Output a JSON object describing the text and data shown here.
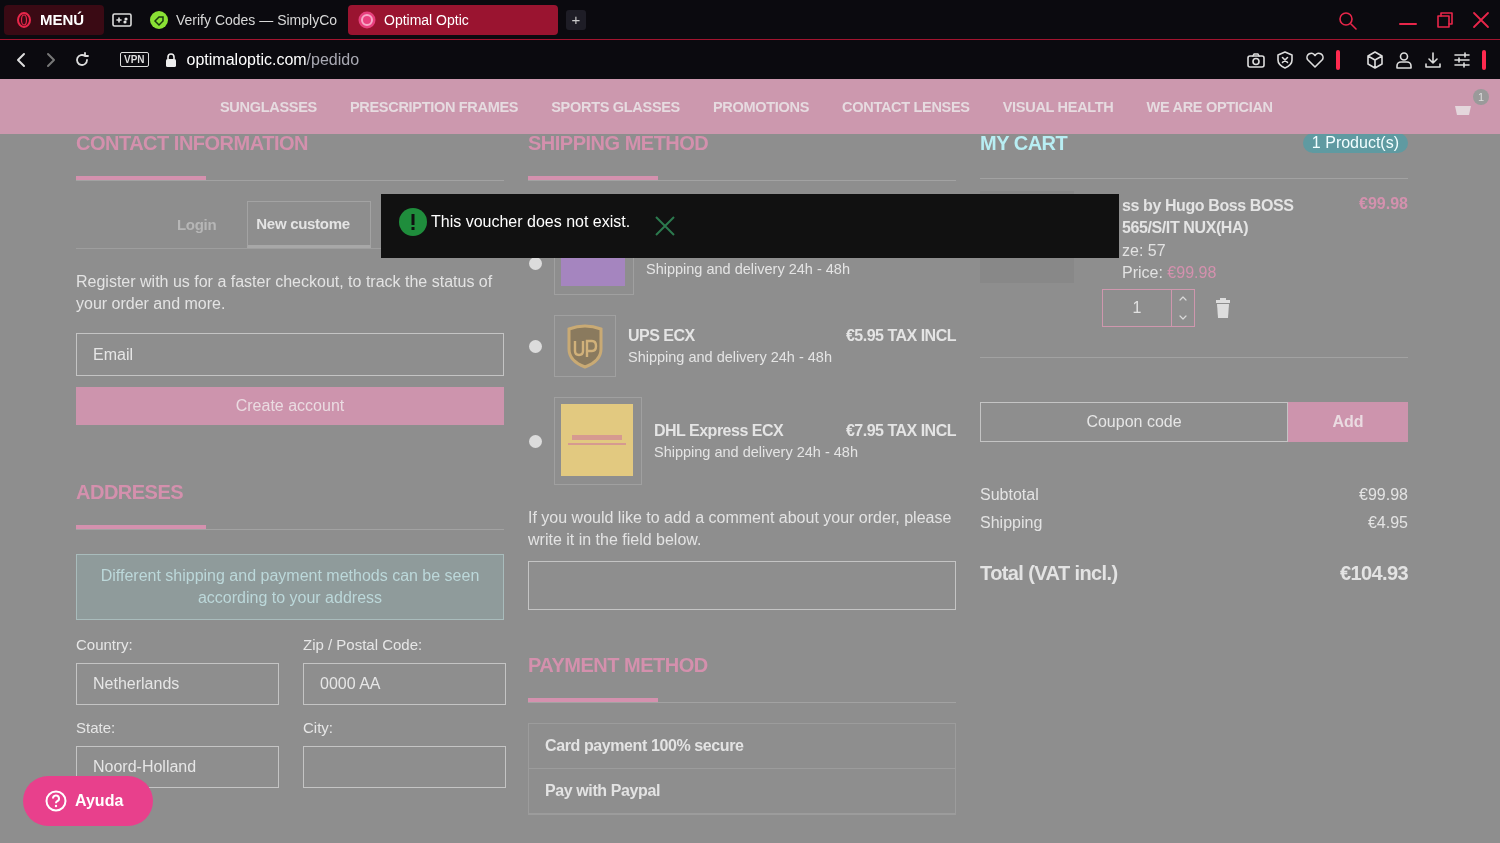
{
  "browser": {
    "menu_label": "MENÚ",
    "tabs": [
      {
        "title": "Verify Codes — SimplyCo",
        "selected": false
      },
      {
        "title": "Optimal Optic",
        "selected": true
      }
    ],
    "new_tab": "+",
    "vpn": "VPN",
    "url_host": "optimaloptic.com",
    "url_path": "/pedido"
  },
  "nav": {
    "items": [
      "SUNGLASSES",
      "PRESCRIPTION FRAMES",
      "SPORTS GLASSES",
      "PROMOTIONS",
      "CONTACT LENSES",
      "VISUAL HEALTH",
      "WE ARE OPTICIAN"
    ],
    "cart_count": "1"
  },
  "contact": {
    "title": "CONTACT INFORMATION",
    "tabs": [
      {
        "label": "Login",
        "selected": false
      },
      {
        "label": "New custome",
        "selected": true
      }
    ],
    "text": "Register with us for a faster checkout, to track the status of your order and more.",
    "email_placeholder": "Email",
    "button": "Create account"
  },
  "addresses": {
    "title": "ADDRESES",
    "notice": "Different shipping and payment methods can be seen according to your address",
    "fields": [
      {
        "label": "Country:",
        "value": "Netherlands"
      },
      {
        "label": "Zip / Postal Code:",
        "value": "0000 AA"
      },
      {
        "label": "State:",
        "value": "Noord-Holland"
      },
      {
        "label": "City:"
      }
    ]
  },
  "shipping": {
    "title": "SHIPPING METHOD",
    "options": [
      {
        "kind": "fedex",
        "selected": false,
        "delivery": "Shipping and delivery 24h - 48h"
      },
      {
        "kind": "ups",
        "selected": false,
        "name": "UPS ECX",
        "price": "€5.95 TAX INCL",
        "delivery": "Shipping and delivery 24h - 48h"
      },
      {
        "kind": "dhl",
        "selected": false,
        "name": "DHL Express ECX",
        "price": "€7.95 TAX INCL",
        "delivery": "Shipping and delivery 24h - 48h"
      }
    ],
    "comment_text": "If you would like to add a comment about your order, please write it in the field below."
  },
  "payment": {
    "title": "PAYMENT METHOD",
    "options": [
      "Card payment 100% secure",
      "Pay with Paypal"
    ]
  },
  "cart": {
    "title": "MY CART",
    "count": "1 Product(s)",
    "product": {
      "name_lines": [
        "ss by Hugo Boss BOSS",
        "565/S/IT NUX(HA)"
      ],
      "line_price": "€99.98",
      "size": "ze: 57",
      "price_label": "Price:",
      "price_value": "€99.98",
      "quantity": "1"
    },
    "coupon_placeholder": "Coupon code",
    "add_button": "Add",
    "summary": [
      {
        "label": "Subtotal",
        "value": "€99.98"
      },
      {
        "label": "Shipping",
        "value": "€4.95"
      }
    ],
    "total_label": "Total (VAT incl.)",
    "total_value": "€104.93"
  },
  "toast": {
    "message": "This voucher does not exist."
  },
  "help_button": "Ayuda"
}
